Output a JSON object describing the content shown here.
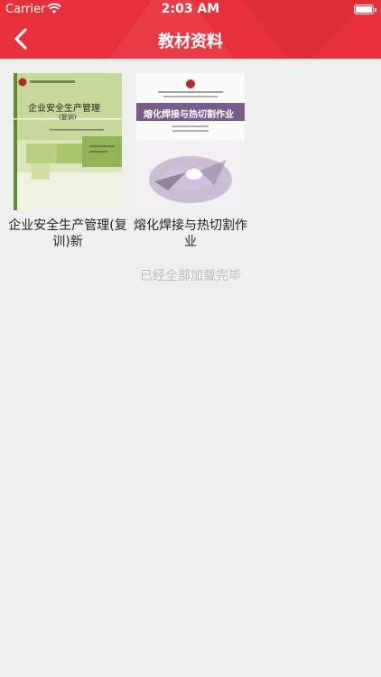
{
  "status_bar": {
    "carrier": "Carrier",
    "time": "2:03 AM"
  },
  "navbar": {
    "title": "教材资料"
  },
  "books": [
    {
      "title": "企业安全生产管理(复训)新",
      "cover_title": "企业安全生产管理",
      "cover_subtitle": "(复训)"
    },
    {
      "title": "熔化焊接与热切割作业",
      "cover_title": "熔化焊接与热切割作业"
    }
  ],
  "footer": {
    "load_complete": "已经全部加载完毕"
  },
  "colors": {
    "brand": "#e8303c",
    "background": "#efefef"
  }
}
